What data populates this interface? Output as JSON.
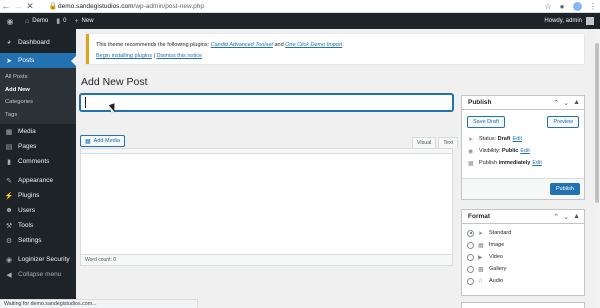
{
  "browser": {
    "url_host": "demo.sandegistudios.com",
    "url_path": "/wp-admin/post-new.php",
    "status_text": "Waiting for demo.sandegistudios.com...",
    "back_icon": "back-arrow-icon",
    "forward_icon": "forward-arrow-icon",
    "close_icon": "close-icon"
  },
  "adminbar": {
    "site_name": "Demo",
    "comments_count": "0",
    "new_label": "New",
    "greeting": "Howdy, admin"
  },
  "sidebar": {
    "items": [
      {
        "label": "Dashboard",
        "icon": "dashboard-icon"
      },
      {
        "label": "Posts",
        "icon": "pin-icon"
      },
      {
        "label": "Media",
        "icon": "media-icon"
      },
      {
        "label": "Pages",
        "icon": "pages-icon"
      },
      {
        "label": "Comments",
        "icon": "comments-icon"
      },
      {
        "label": "Appearance",
        "icon": "appearance-icon"
      },
      {
        "label": "Plugins",
        "icon": "plugins-icon"
      },
      {
        "label": "Users",
        "icon": "users-icon"
      },
      {
        "label": "Tools",
        "icon": "tools-icon"
      },
      {
        "label": "Settings",
        "icon": "settings-icon"
      },
      {
        "label": "Loginizer Security",
        "icon": "lock-icon"
      },
      {
        "label": "Collapse menu",
        "icon": "collapse-icon"
      }
    ],
    "posts_submenu": [
      "All Posts",
      "Add New",
      "Categories",
      "Tags"
    ]
  },
  "notice": {
    "text_before": "This theme recommends the following plugins: ",
    "plugin1": "Candid Advanced Toolset",
    "and": " and ",
    "plugin2": "One Click Demo Import",
    "period": ".",
    "link_install": "Begin installing plugins",
    "separator": " | ",
    "link_dismiss": "Dismiss this notice"
  },
  "main": {
    "page_title": "Add New Post",
    "title_value": "",
    "add_media_label": "Add Media",
    "tab_visual": "Visual",
    "tab_text": "Text",
    "word_count_label": "Word count: 0"
  },
  "publish": {
    "title": "Publish",
    "save_draft": "Save Draft",
    "preview": "Preview",
    "status_label": "Status:",
    "status_value": "Draft",
    "visibility_label": "Visibility:",
    "visibility_value": "Public",
    "publish_label": "Publish",
    "publish_value": "immediately",
    "edit": "Edit",
    "publish_button": "Publish"
  },
  "format": {
    "title": "Format",
    "options": [
      "Standard",
      "Image",
      "Video",
      "Gallery",
      "Audio"
    ],
    "selected": "Standard"
  },
  "colors": {
    "accent": "#2271b1",
    "admin_dark": "#1d2327",
    "notice_warning": "#dba617"
  }
}
